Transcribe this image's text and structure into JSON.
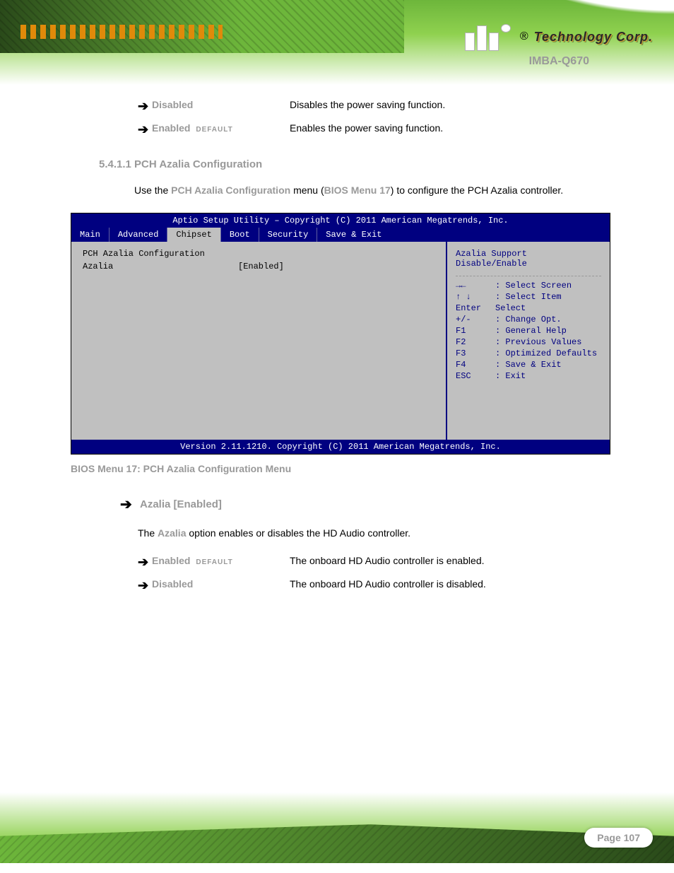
{
  "logo": {
    "registered": "®",
    "text": "Technology Corp."
  },
  "page_model": "IMBA-Q670",
  "options1": [
    {
      "label": "Disabled",
      "sub": "",
      "desc": "Disables the power saving function."
    },
    {
      "label": "Enabled",
      "sub": "DEFAULT",
      "desc": "Enables the power saving function."
    }
  ],
  "section_number": "5.4.1.1",
  "section_title": "PCH Azalia Configuration",
  "intro": {
    "prefix": "Use the ",
    "menu_name": "PCH Azalia Configuration",
    "mid": " menu (",
    "ref": "BIOS Menu 17",
    "suffix": ") to configure the PCH Azalia controller."
  },
  "bios": {
    "title": "Aptio Setup Utility – Copyright (C) 2011 American Megatrends, Inc.",
    "tabs": [
      "Main",
      "Advanced",
      "Chipset",
      "Boot",
      "Security",
      "Save & Exit"
    ],
    "active_tab_index": 2,
    "left": {
      "heading": "PCH Azalia Configuration",
      "setting_label": "Azalia",
      "setting_value": "[Enabled]"
    },
    "right": {
      "hint1": "Azalia Support",
      "hint2": "Disable/Enable",
      "keys": [
        {
          "k": "→←",
          "d": ": Select Screen"
        },
        {
          "k": "↑ ↓",
          "d": ": Select Item"
        },
        {
          "k": "Enter",
          "d": "Select"
        },
        {
          "k": "+/-",
          "d": ": Change Opt."
        },
        {
          "k": "F1",
          "d": ": General Help"
        },
        {
          "k": "F2",
          "d": ": Previous Values"
        },
        {
          "k": "F3",
          "d": ": Optimized Defaults"
        },
        {
          "k": "F4",
          "d": ": Save & Exit"
        },
        {
          "k": "ESC",
          "d": ": Exit"
        }
      ]
    },
    "footer": "Version 2.11.1210. Copyright (C) 2011 American Megatrends, Inc."
  },
  "figure_caption": "BIOS Menu 17: PCH Azalia Configuration Menu",
  "azalia": {
    "heading": "Azalia [Enabled]",
    "para_pre": "The ",
    "para_bold": "Azalia",
    "para_post": " option enables or disables the HD Audio controller.",
    "options": [
      {
        "label": "Enabled",
        "sub": "DEFAULT",
        "desc": "The onboard HD Audio controller is enabled."
      },
      {
        "label": "Disabled",
        "sub": "",
        "desc": "The onboard HD Audio controller is disabled."
      }
    ]
  },
  "page_label": "Page 107"
}
